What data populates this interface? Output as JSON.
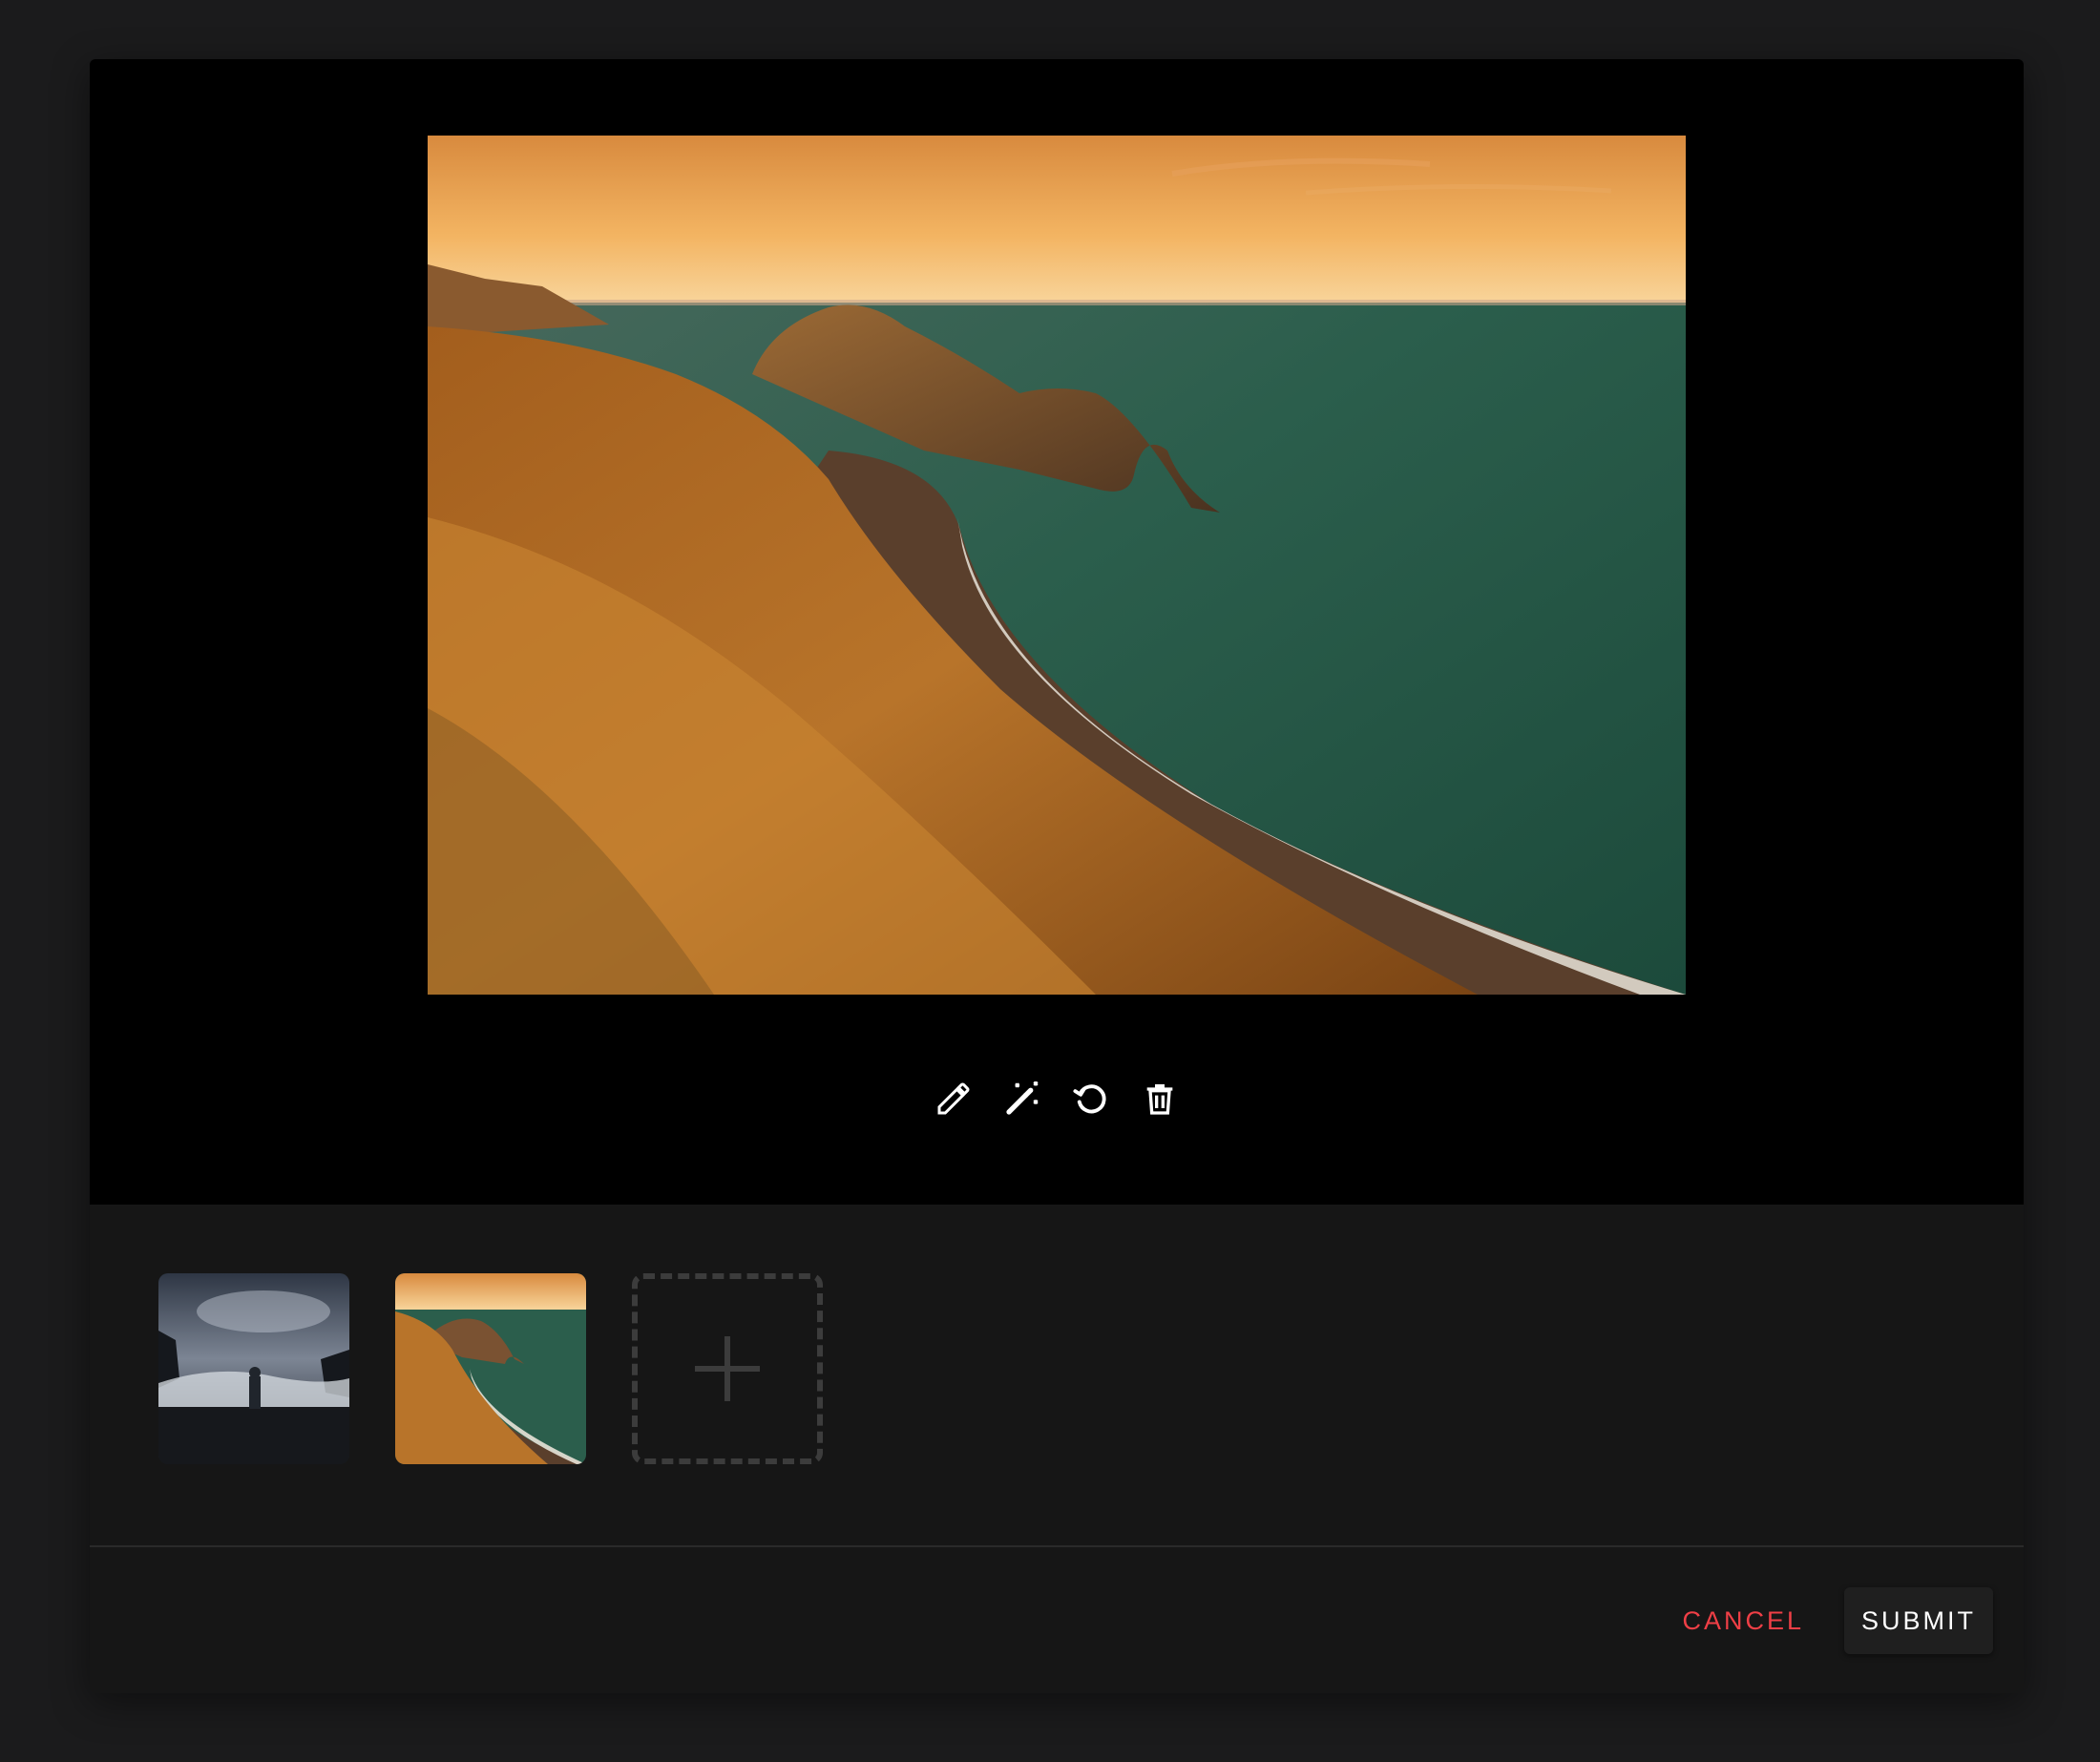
{
  "preview": {
    "main_image": "coastal-arch-sunset-photo",
    "tools": [
      {
        "icon": "pencil-icon"
      },
      {
        "icon": "magic-wand-icon"
      },
      {
        "icon": "rotate-icon"
      },
      {
        "icon": "trash-icon"
      }
    ]
  },
  "gallery": {
    "thumbnails": [
      {
        "image": "stormy-shore-hiker-photo"
      },
      {
        "image": "coastal-arch-sunset-photo"
      }
    ],
    "add_icon": "plus-icon"
  },
  "actions": {
    "cancel_label": "CANCEL",
    "submit_label": "SUBMIT"
  },
  "colors": {
    "cancel": "#ef3f46",
    "background": "#161616",
    "preview_background": "#000000"
  }
}
